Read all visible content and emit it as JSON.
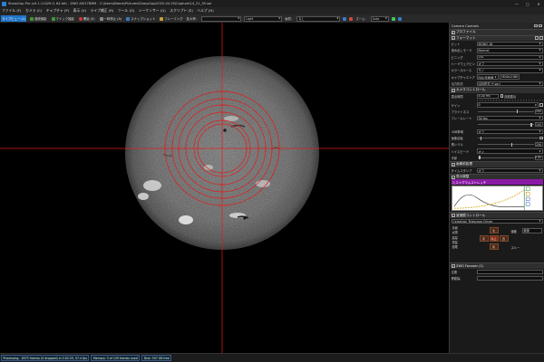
{
  "titlebar": {
    "title": "SharpCap Pro (v4.1.11429.0, 64 bit) - ZWO ASI178MM - C:\\Users\\Name\\Pictures\\SharpCap\\2025-04-20\\Capture\\14_21_35.ser",
    "min": "—",
    "max": "▢",
    "close": "✕"
  },
  "menubar": [
    "ファイル (F)",
    "カメラ (C)",
    "キャプチャ (P)",
    "表示 (V)",
    "ライブ補正 (R)",
    "ツール (O)",
    "シーケンサー (Q)",
    "スクリプト (S)",
    "ヘルプ (H)"
  ],
  "toolbar": {
    "live_view": "ライブビュー (L)",
    "sequence": "連続撮影",
    "quick": "クイック撮影",
    "start": "開始 (S)",
    "pause": "一時停止 (A)",
    "snapshot": "スナップショット",
    "framing": "フレーミング",
    "scale_label": "拡大率：",
    "scale_value": "",
    "light_value": "Light",
    "frame_label": "画質：",
    "frame_value": "なし",
    "auto_value": "Auto",
    "zoom_label": "ズーム："
  },
  "status": {
    "processing": "Processing - 8375 frames (0 dropped) in 0:02:25, 57.4 fps",
    "memory": "Memory: 3 of 129 frames used",
    "disk": "Disk: 507 GB free"
  },
  "panel": {
    "header": "Camera Controls",
    "sec_profile": "プロファイル",
    "sec_format": "フォーマット",
    "format_rows": [
      {
        "label": "ビット",
        "value": "MONO 16"
      },
      {
        "label": "読み出しモード",
        "value": "Normal"
      },
      {
        "label": "ビニング",
        "value": "1x1"
      },
      {
        "label": "ハードウェアビン",
        "value": "オフ"
      },
      {
        "label": "カラースペース",
        "value": "モノ"
      }
    ],
    "capture_area_label": "キャプチャエリア",
    "capture_area_value": "ROI/全画面",
    "capture_area_size": "3840x2160",
    "output_label": "出力形式",
    "output_value": "SER形式 (*.ser)",
    "sec_camera": "カメラコントロール",
    "exposure_label": "露出時間",
    "exposure_value": "4.00 ms",
    "auto_label": "自動露出",
    "gain_label": "ゲイン",
    "gain_value": "0",
    "brightness_label": "ブライトネス",
    "brightness_value": "200",
    "framerate_label": "フレームレート",
    "framerate_value": "30 fps",
    "frame_skip_label": "",
    "frame_skip_value": "100",
    "usb_label": "USB帯域",
    "usb_value": "オフ",
    "black_label": "黒レベル",
    "black_value": "256",
    "flip_label": "画像反転",
    "flip_value": "なし",
    "highspeed_label": "ハイスピード",
    "highspeed_value": "オン",
    "cooler_label": "冷却",
    "cooler_value": "0.00",
    "sec_preproc": "画像前処理",
    "timestamp_label": "タイムスタンプ",
    "timestamp_value": "オフ",
    "sec_histogram": "表示調整",
    "histogram_title": "ヒストグラムストレッチ",
    "sec_telescope": "望遠鏡コントロール",
    "telescope_driver": "Celestron Telescope Driver",
    "sky_items": [
      "月面",
      "太陽",
      "惑星",
      "恒星",
      "追尾"
    ],
    "pad": {
      "north": "北",
      "south": "南",
      "east": "東",
      "west": "西",
      "center": "停止"
    },
    "rate_label": "速度",
    "rate_value": "最速",
    "slew_label": "スルー",
    "sec_focuser": "ZWO Focuser (1)",
    "focuser_rows": [
      "位置",
      "移動幅"
    ]
  }
}
